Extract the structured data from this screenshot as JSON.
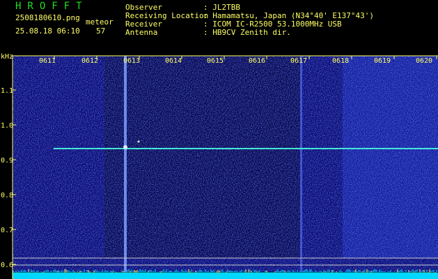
{
  "header": {
    "title": "HROFFT",
    "filename": "2508180610.png",
    "datetime": "25.08.18 06:10",
    "meteor_label": "meteor",
    "meteor_count": "57",
    "fields": [
      {
        "label": "Observer",
        "value": ": JL2TBB"
      },
      {
        "label": "Receiving Location",
        "value": ": Hamamatsu, Japan (N34°40' E137°43')"
      },
      {
        "label": "Receiver",
        "value": ": ICOM IC-R2500 53.1000MHz USB"
      },
      {
        "label": "Antenna",
        "value": ": HB9CV Zenith dir."
      }
    ]
  },
  "axes": {
    "y_unit": "kHz",
    "y_ticks": [
      "1.1",
      "1.0",
      "0.9",
      "0.8",
      "0.7",
      "0.6"
    ],
    "x_ticks": [
      "0611",
      "0612",
      "0613",
      "0614",
      "0615",
      "0616",
      "0617",
      "0618",
      "0619",
      "0620"
    ]
  },
  "colors": {
    "text": "#ffff66",
    "title": "#22dd22",
    "background": "#000000",
    "noise_low": "#0a0a6e",
    "noise_high": "#2f4dff",
    "signal": "#44e8d8"
  }
}
